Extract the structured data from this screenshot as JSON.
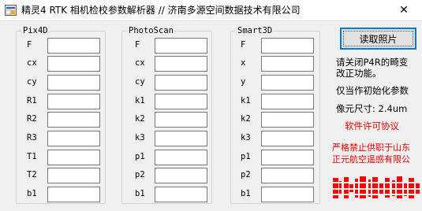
{
  "window": {
    "title": "精灵4 RTK 相机检校参数解析器 // 济南多源空间数据技术有限公司",
    "close_glyph": "✕"
  },
  "groups": [
    {
      "title": "Pix4D",
      "labels": [
        "F",
        "cx",
        "cy",
        "R1",
        "R2",
        "R3",
        "T1",
        "T2",
        "b1"
      ]
    },
    {
      "title": "PhotoScan",
      "labels": [
        "F",
        "cx",
        "cy",
        "k1",
        "k2",
        "k3",
        "p1",
        "p2",
        "b1"
      ]
    },
    {
      "title": "Smart3D",
      "labels": [
        "F",
        "x",
        "y",
        "k1",
        "k2",
        "k3",
        "p1",
        "p2",
        "b1"
      ]
    }
  ],
  "read_button_label": "读取照片",
  "notes": {
    "close_p4_line1": "请关闭P4R的畸变",
    "close_p4_line2": "改正功能。",
    "init_only": "仅当作初始化参数",
    "pixel_size": "像元尺寸: 2.4um",
    "license": "软件许可协议",
    "restriction_line1": "严格禁止供职于山东",
    "restriction_line2": "正元航空遥感有限公"
  },
  "colors": {
    "accent": "#0078d7",
    "warning": "#ff0000"
  },
  "icons": {
    "app": "app-icon",
    "close": "close-icon"
  }
}
